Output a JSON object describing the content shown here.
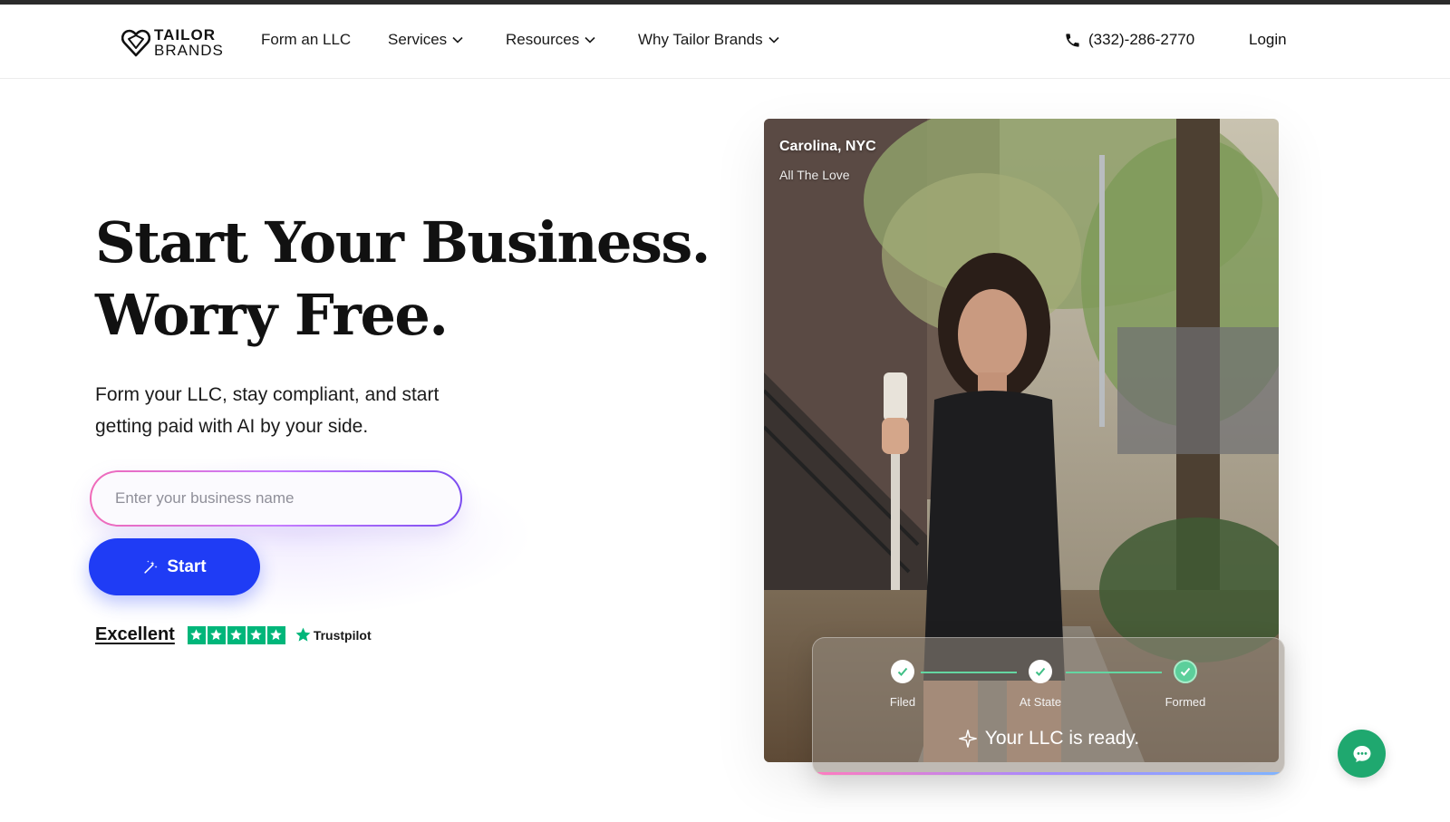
{
  "nav": {
    "logo_line1": "TAILOR",
    "logo_line2": "BRANDS",
    "items": [
      {
        "label": "Form an LLC",
        "has_dropdown": false
      },
      {
        "label": "Services",
        "has_dropdown": true
      },
      {
        "label": "Resources",
        "has_dropdown": true
      },
      {
        "label": "Why Tailor Brands",
        "has_dropdown": true
      }
    ],
    "phone": "(332)-286-2770",
    "login": "Login"
  },
  "hero": {
    "title_line1": "Start Your Business.",
    "title_line2": "Worry Free.",
    "subtitle": "Form your LLC, stay compliant, and start getting paid with AI by your side.",
    "input_placeholder": "Enter your business name",
    "start_label": "Start"
  },
  "trustpilot": {
    "rating_text": "Excellent",
    "stars": 5,
    "brand": "Trustpilot"
  },
  "testimonial": {
    "name": "Carolina, NYC",
    "business": "All The Love"
  },
  "status": {
    "steps": [
      {
        "label": "Filed"
      },
      {
        "label": "At State"
      },
      {
        "label": "Formed"
      }
    ],
    "message": "Your LLC is ready."
  },
  "colors": {
    "accent_blue": "#1f3cf5",
    "trustpilot_green": "#00b67a",
    "chat_green": "#1fa86f"
  },
  "icons": [
    "logo-heart-icon",
    "chevron-down-icon",
    "phone-icon",
    "magic-wand-icon",
    "star-icon",
    "sparkle-icon",
    "check-icon",
    "chat-bubble-icon"
  ]
}
